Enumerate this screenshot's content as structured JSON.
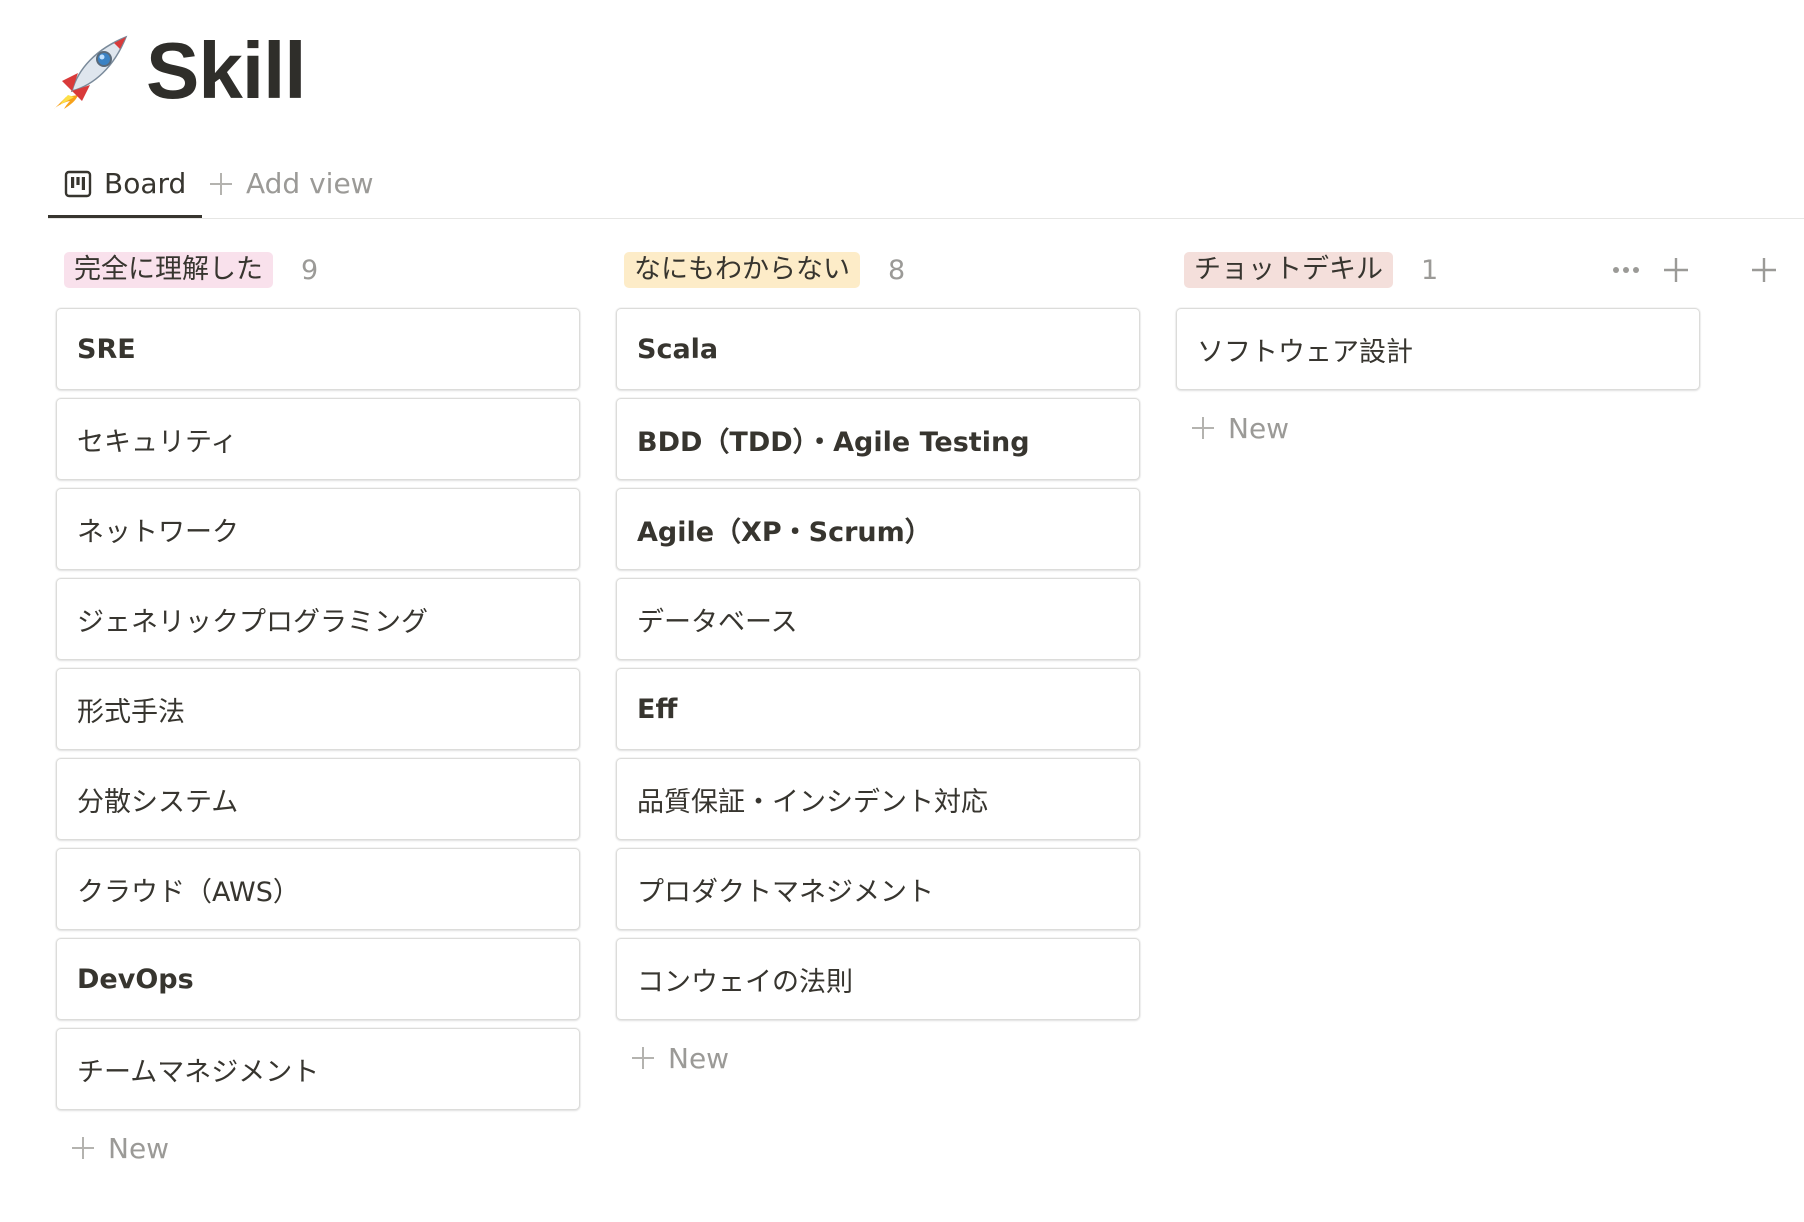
{
  "page": {
    "icon": "rocket-icon",
    "title": "Skill"
  },
  "views": {
    "active_tab": {
      "icon": "board-icon",
      "label": "Board"
    },
    "add_view": {
      "icon": "plus-icon",
      "label": "Add view"
    }
  },
  "board": {
    "columns": [
      {
        "label": "完全に理解した",
        "count": "9",
        "tag_color": "#f9e1ec",
        "cards": [
          {
            "title": "SRE",
            "bold": true
          },
          {
            "title": "セキュリティ",
            "bold": false
          },
          {
            "title": "ネットワーク",
            "bold": false
          },
          {
            "title": "ジェネリックプログラミング",
            "bold": false
          },
          {
            "title": "形式手法",
            "bold": false
          },
          {
            "title": "分散システム",
            "bold": false
          },
          {
            "title": "クラウド（AWS）",
            "bold": false
          },
          {
            "title": "DevOps",
            "bold": true
          },
          {
            "title": "チームマネジメント",
            "bold": false
          }
        ],
        "new_label": "New"
      },
      {
        "label": "なにもわからない",
        "count": "8",
        "tag_color": "#fdecc8",
        "cards": [
          {
            "title": "Scala",
            "bold": true
          },
          {
            "title": "BDD（TDD）・Agile Testing",
            "bold": true
          },
          {
            "title": "Agile（XP・Scrum）",
            "bold": true
          },
          {
            "title": "データベース",
            "bold": false
          },
          {
            "title": "Eff",
            "bold": true
          },
          {
            "title": "品質保証・インシデント対応",
            "bold": false
          },
          {
            "title": "プロダクトマネジメント",
            "bold": false
          },
          {
            "title": "コンウェイの法則",
            "bold": false
          }
        ],
        "new_label": "New"
      },
      {
        "label": "チョットデキル",
        "count": "1",
        "tag_color": "#f4dfdb",
        "cards": [
          {
            "title": "ソフトウェア設計",
            "bold": false
          }
        ],
        "new_label": "New"
      }
    ],
    "column_actions": [
      "more-icon",
      "plus-icon"
    ],
    "add_group_icon": "plus-icon"
  }
}
